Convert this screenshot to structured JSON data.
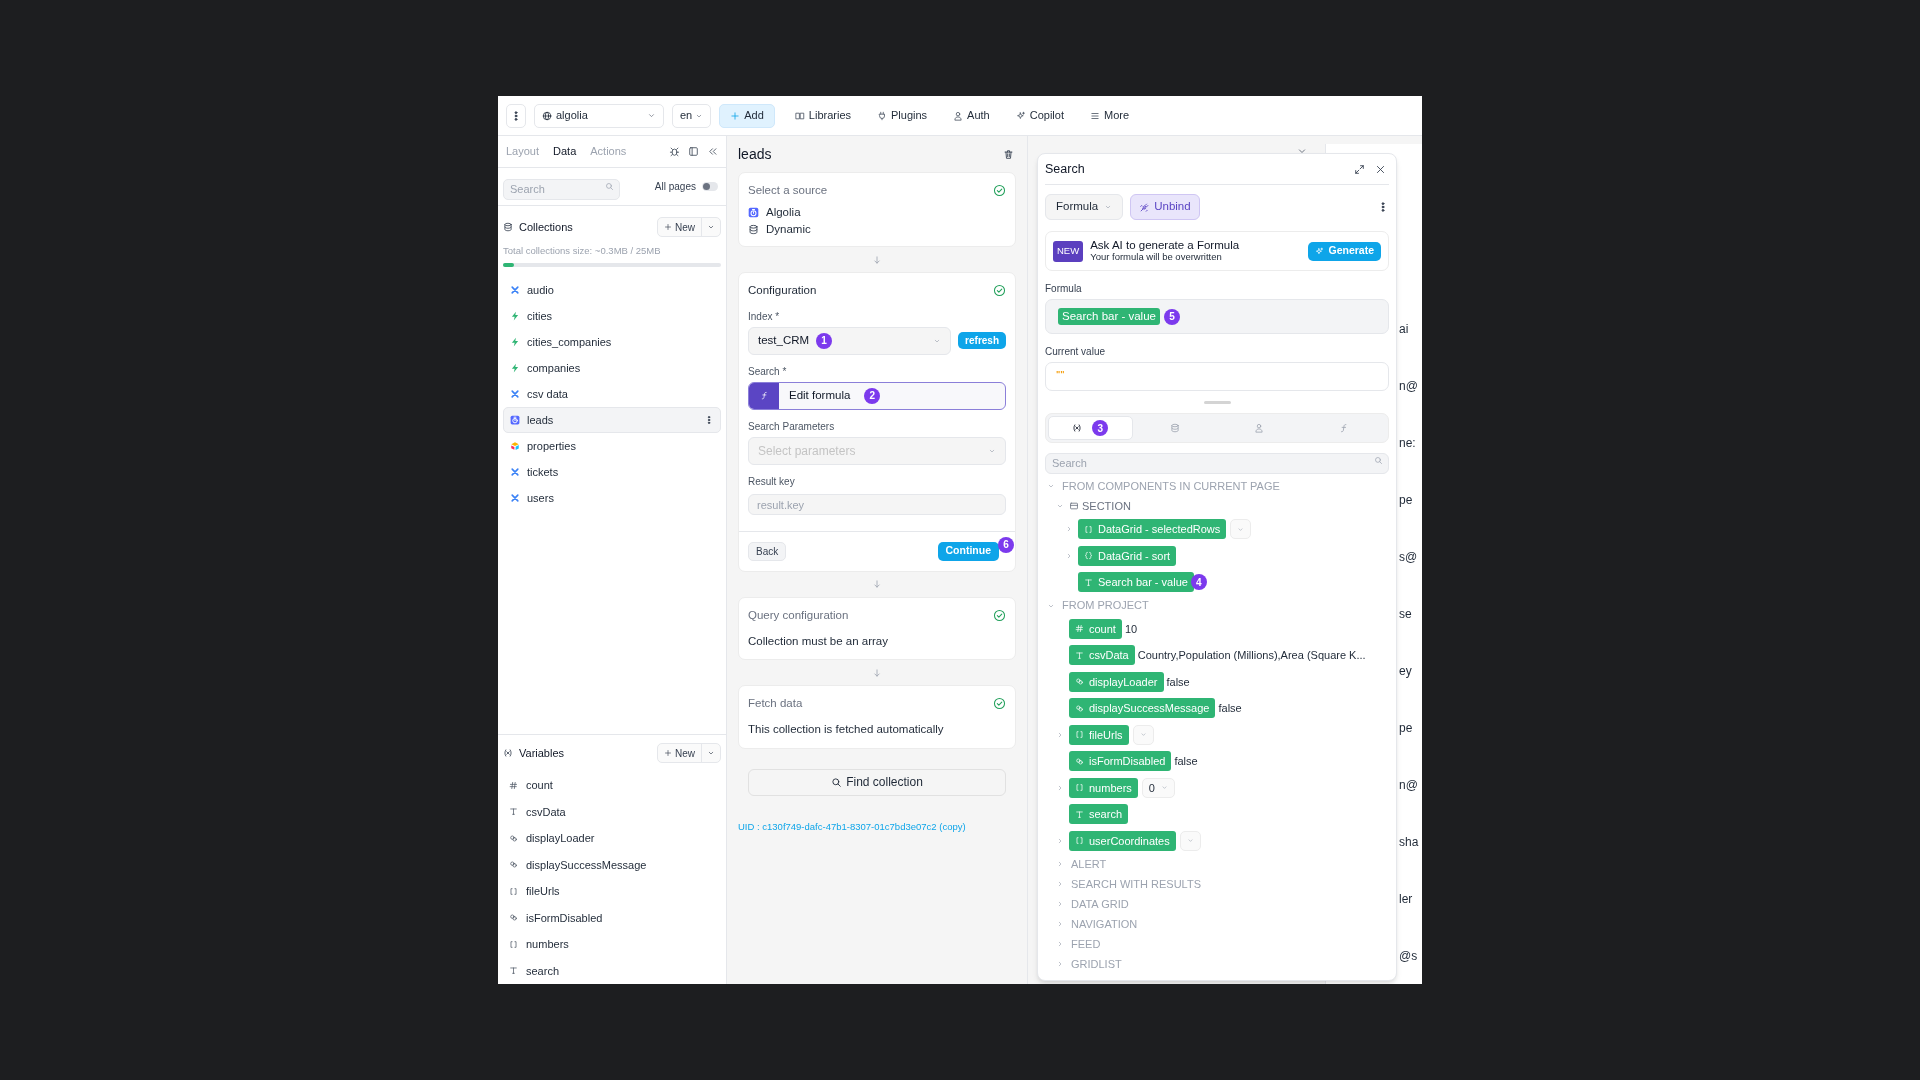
{
  "toolbar": {
    "project": "algolia",
    "language": "en",
    "buttons": [
      {
        "label": "Add",
        "kind": "primary"
      },
      {
        "label": "Libraries",
        "kind": "plain"
      },
      {
        "label": "Plugins",
        "kind": "plain"
      },
      {
        "label": "Auth",
        "kind": "plain"
      },
      {
        "label": "Copilot",
        "kind": "plain"
      },
      {
        "label": "More",
        "kind": "plain"
      }
    ]
  },
  "left_panel": {
    "tabs": [
      {
        "label": "Layout",
        "selected": false
      },
      {
        "label": "Data",
        "selected": true
      },
      {
        "label": "Actions",
        "selected": false
      }
    ],
    "search": {
      "placeholder": "Search"
    },
    "all_pages": {
      "label": "All pages",
      "on": false
    },
    "collections": {
      "title": "Collections",
      "new_button": "New",
      "size_text": "Total collections size: ~0.3MB / 25MB",
      "level": 0.05,
      "items": [
        {
          "label": "audio",
          "kind": "cross",
          "selected": false
        },
        {
          "label": "cities",
          "kind": "bolt",
          "selected": false
        },
        {
          "label": "cities_companies",
          "kind": "bolt",
          "selected": false
        },
        {
          "label": "companies",
          "kind": "bolt",
          "selected": false
        },
        {
          "label": "csv data",
          "kind": "cross",
          "selected": false
        },
        {
          "label": "leads",
          "kind": "timer",
          "selected": true
        },
        {
          "label": "properties",
          "kind": "tiles",
          "selected": false
        },
        {
          "label": "tickets",
          "kind": "cross",
          "selected": false
        },
        {
          "label": "users",
          "kind": "cross",
          "selected": false
        }
      ]
    },
    "variables": {
      "title": "Variables",
      "new_button": "New",
      "items": [
        {
          "label": "count",
          "kind": "number"
        },
        {
          "label": "csvData",
          "kind": "text"
        },
        {
          "label": "displayLoader",
          "kind": "boolean"
        },
        {
          "label": "displaySuccessMessage",
          "kind": "boolean"
        },
        {
          "label": "fileUrls",
          "kind": "array"
        },
        {
          "label": "isFormDisabled",
          "kind": "boolean"
        },
        {
          "label": "numbers",
          "kind": "array"
        },
        {
          "label": "search",
          "kind": "text"
        }
      ]
    }
  },
  "middle_panel": {
    "title": "leads",
    "source_card": {
      "title": "Select a source",
      "done": true,
      "sources": [
        {
          "label": "Algolia"
        },
        {
          "label": "Dynamic"
        }
      ]
    },
    "config_card": {
      "title": "Configuration",
      "done": true,
      "index": {
        "label": "Index *",
        "value": "test_CRM",
        "badge": "1"
      },
      "refresh": "refresh",
      "search": {
        "label": "Search *",
        "value": "Edit formula",
        "badge": "2"
      },
      "params": {
        "label": "Search Parameters",
        "placeholder": "Select parameters"
      },
      "result_key": {
        "label": "Result key",
        "placeholder": "result.key"
      },
      "back": "Back",
      "continue": "Continue",
      "continue_badge": "6"
    },
    "steps": [
      {
        "title": "Query configuration",
        "text": "Collection must be an array",
        "done": true
      },
      {
        "title": "Fetch data",
        "text": "This collection is fetched automatically",
        "done": true
      }
    ],
    "find_button": "Find collection",
    "uid": "UID : c130f749-dafc-47b1-8307-01c7bd3e07c2 (copy)"
  },
  "background_fragments": [
    "ai",
    "n@",
    "ne:",
    "pe",
    "s@",
    "se",
    "ey",
    "pe",
    "n@",
    "sha",
    "ler",
    "@s"
  ],
  "popup": {
    "title": "Search",
    "mode": "Formula",
    "unbind": "Unbind",
    "ai": {
      "badge": "NEW",
      "title": "Ask AI to generate a Formula",
      "subtitle": "Your formula will be overwritten",
      "button": "Generate"
    },
    "formula": {
      "label": "Formula",
      "chip": "Search bar - value",
      "badge": "5"
    },
    "current_value": {
      "label": "Current value",
      "value": "\"\""
    },
    "tabs": [
      {
        "selected": true,
        "badge": "3"
      },
      {
        "selected": false
      },
      {
        "selected": false
      },
      {
        "selected": false
      }
    ],
    "search": {
      "placeholder": "Search"
    },
    "tree": [
      {
        "kind": "group",
        "label": "FROM COMPONENTS IN CURRENT PAGE",
        "expanded": true,
        "children": [
          {
            "kind": "section",
            "label": "SECTION",
            "expanded": true,
            "children": [
              {
                "kind": "array",
                "label": "DataGrid - selectedRows",
                "expanded": false,
                "dropdown": true
              },
              {
                "kind": "object",
                "label": "DataGrid - sort",
                "expanded": false
              },
              {
                "kind": "text",
                "label": "Search bar - value",
                "badge": "4"
              }
            ]
          }
        ]
      },
      {
        "kind": "group",
        "label": "FROM PROJECT",
        "expanded": true,
        "children": [
          {
            "kind": "number",
            "label": "count",
            "value": "10"
          },
          {
            "kind": "text",
            "label": "csvData",
            "value": "Country,Population (Millions),Area (Square K..."
          },
          {
            "kind": "boolean",
            "label": "displayLoader",
            "value": "false"
          },
          {
            "kind": "boolean",
            "label": "displaySuccessMessage",
            "value": "false"
          },
          {
            "kind": "array",
            "label": "fileUrls",
            "expanded": false,
            "dropdown": true
          },
          {
            "kind": "boolean",
            "label": "isFormDisabled",
            "value": "false"
          },
          {
            "kind": "array",
            "label": "numbers",
            "expanded": false,
            "dropdown": true,
            "dropdown_value": "0"
          },
          {
            "kind": "text",
            "label": "search"
          },
          {
            "kind": "array",
            "label": "userCoordinates",
            "expanded": false,
            "dropdown": true
          },
          {
            "kind": "group",
            "label": "ALERT",
            "expanded": false
          },
          {
            "kind": "group",
            "label": "SEARCH WITH RESULTS",
            "expanded": false
          },
          {
            "kind": "group",
            "label": "DATA GRID",
            "expanded": false
          },
          {
            "kind": "group",
            "label": "NAVIGATION",
            "expanded": false
          },
          {
            "kind": "group",
            "label": "FEED",
            "expanded": false
          },
          {
            "kind": "group",
            "label": "GRIDLIST",
            "expanded": false
          }
        ]
      }
    ]
  }
}
